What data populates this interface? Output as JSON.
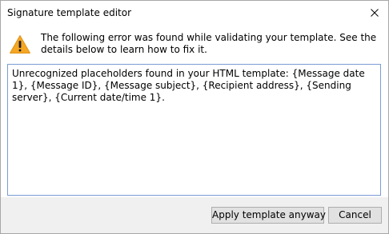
{
  "window": {
    "title": "Signature template editor",
    "close_icon": "close-icon"
  },
  "message": {
    "icon": "warning-icon",
    "text": "The following error was found while validating your template. See the details below to learn how to fix it."
  },
  "details": {
    "text": "Unrecognized placeholders found in your HTML template: {Message date 1}, {Message ID}, {Message subject}, {Recipient address}, {Sending server}, {Current date/time 1}."
  },
  "buttons": {
    "apply_label": "Apply template anyway",
    "cancel_label": "Cancel"
  },
  "colors": {
    "warning_fill": "#f5a623",
    "details_border": "#7a9cd3",
    "footer_background": "#f0f0f0",
    "button_face": "#e1e1e1"
  }
}
